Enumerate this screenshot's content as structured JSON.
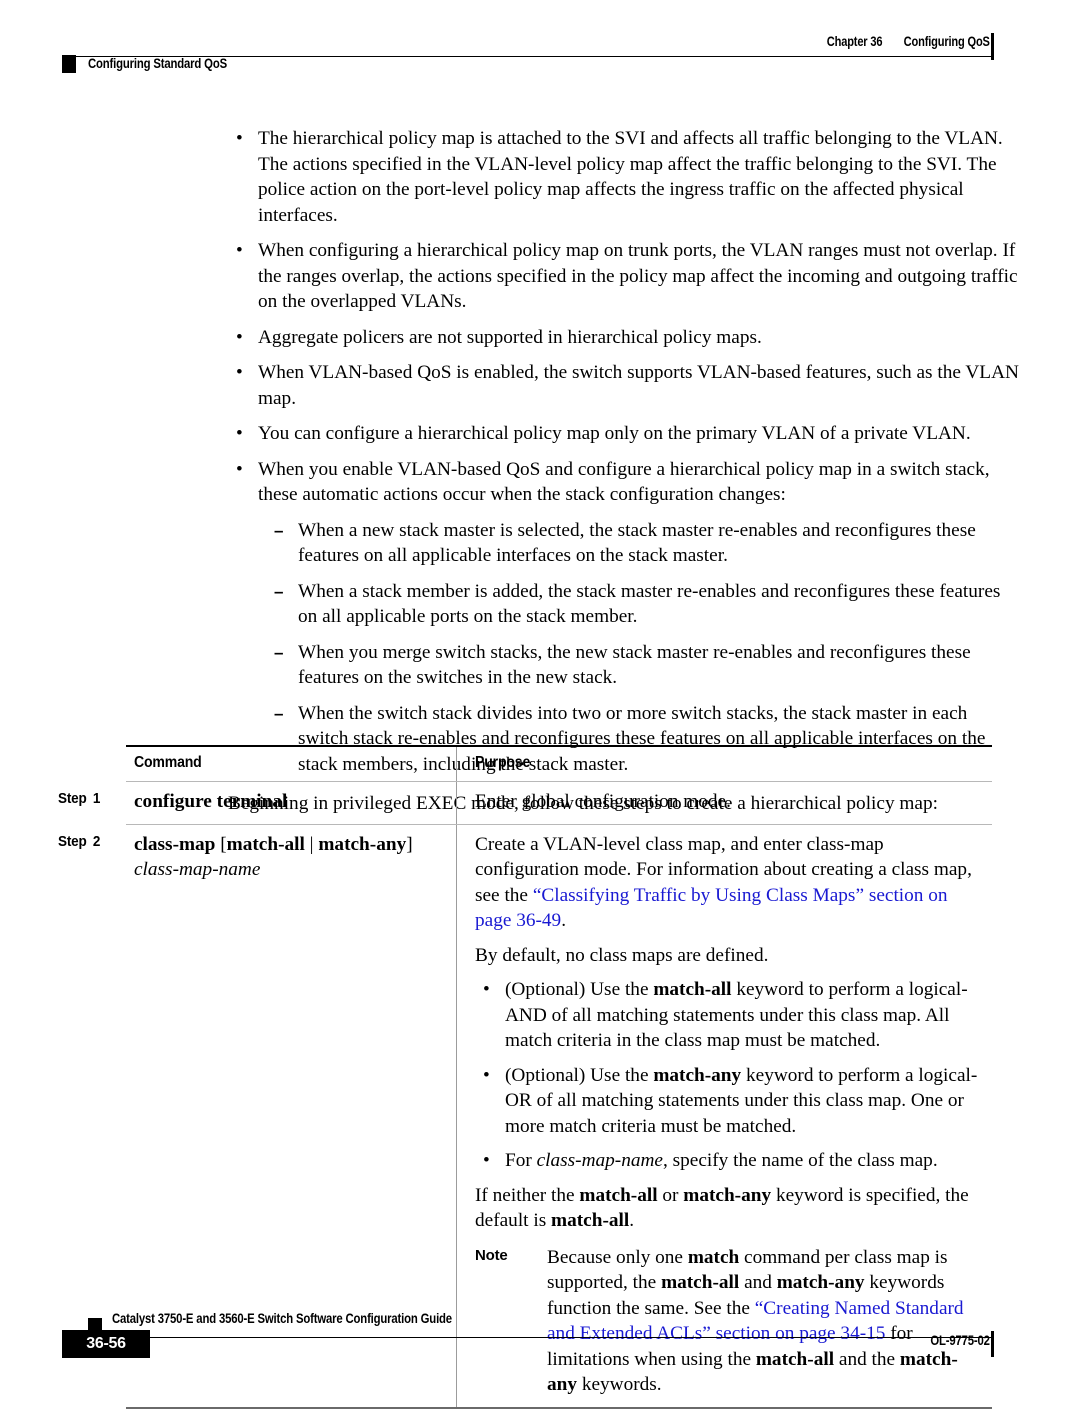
{
  "header": {
    "chapter": "Chapter 36",
    "chapter_title": "Configuring QoS",
    "section_title": "Configuring Standard QoS"
  },
  "body": {
    "bullets": [
      {
        "marker": "•",
        "text": "The hierarchical policy map is attached to the SVI and affects all traffic belonging to the VLAN. The actions specified in the VLAN-level policy map affect the traffic belonging to the SVI. The police action on the port-level policy map affects the ingress traffic on the affected physical interfaces."
      },
      {
        "marker": "•",
        "text": "When configuring a hierarchical policy map on trunk ports, the VLAN ranges must not overlap. If the ranges overlap, the actions specified in the policy map affect the incoming and outgoing traffic on the overlapped VLANs."
      },
      {
        "marker": "•",
        "text": "Aggregate policers are not supported in hierarchical policy maps."
      },
      {
        "marker": "•",
        "text": "When VLAN-based QoS is enabled, the switch supports VLAN-based features, such as the VLAN map."
      },
      {
        "marker": "•",
        "text": "You can configure a hierarchical policy map only on the primary VLAN of a private VLAN."
      },
      {
        "marker": "•",
        "text": "When you enable VLAN-based QoS and configure a hierarchical policy map in a switch stack, these automatic actions occur when the stack configuration changes:"
      }
    ],
    "sub_bullets": [
      {
        "marker": "–",
        "text": "When a new stack master is selected, the stack master re-enables and reconfigures these features on all applicable interfaces on the stack master."
      },
      {
        "marker": "–",
        "text": "When a stack member is added, the stack master re-enables and reconfigures these features on all applicable ports on the stack member."
      },
      {
        "marker": "–",
        "text": "When you merge switch stacks, the new stack master re-enables and reconfigures these features on the switches in the new stack."
      },
      {
        "marker": "–",
        "text": "When the switch stack divides into two or more switch stacks, the stack master in each switch stack re-enables and reconfigures these features on all applicable interfaces on the stack members, including the stack master."
      }
    ],
    "intro_paragraph": "Beginning in privileged EXEC mode, follow these steps to create a hierarchical policy map:"
  },
  "table": {
    "headers": {
      "command": "Command",
      "purpose": "Purpose"
    },
    "rows": [
      {
        "step_word": "Step",
        "step_number": "1",
        "command_bold": "configure terminal",
        "command_italic": "",
        "purpose_text": "Enter global configuration mode."
      },
      {
        "step_word": "Step",
        "step_number": "2",
        "command_prefix": "class-map",
        "command_bracket_open": " [",
        "command_opt1": "match-all",
        "command_pipe": " | ",
        "command_opt2": "match-any",
        "command_bracket_close": "]",
        "command_italic": "class-map-name",
        "purpose": {
          "p1_a": "Create a VLAN-level class map, and enter class-map configuration mode. For information about creating a class map, see the ",
          "p1_link": "“Classifying Traffic by Using Class Maps” section on page 36-49",
          "p1_b": ".",
          "p2": "By default, no class maps are defined.",
          "b1_a": "(Optional) Use the ",
          "b1_kw": "match-all",
          "b1_b": " keyword to perform a logical-AND of all matching statements under this class map. All match criteria in the class map must be matched.",
          "b2_a": "(Optional) Use the ",
          "b2_kw": "match-any",
          "b2_b": " keyword to perform a logical-OR of all matching statements under this class map. One or more match criteria must be matched.",
          "b3_a": "For ",
          "b3_italic": "class-map-name",
          "b3_b": ", specify the name of the class map.",
          "p3_a": "If neither the ",
          "p3_kw1": "match-all",
          "p3_b": " or ",
          "p3_kw2": "match-any",
          "p3_c": " keyword is specified, the default is ",
          "p3_kw3": "match-all",
          "p3_d": ".",
          "note_tag": "Note",
          "note_a": "Because only one ",
          "note_kw1": "match",
          "note_b": " command per class map is supported, the ",
          "note_kw2": "match-all",
          "note_c": " and ",
          "note_kw3": "match-any",
          "note_d": " keywords function the same. See the ",
          "note_link": "“Creating Named Standard and Extended ACLs” section on page 34-15",
          "note_e": " for limitations when using the ",
          "note_kw4": "match-all",
          "note_f": " and the ",
          "note_kw5": "match-any",
          "note_g": " keywords."
        }
      }
    ]
  },
  "footer": {
    "doc_title": "Catalyst 3750-E and 3560-E Switch Software Configuration Guide",
    "page_number": "36-56",
    "doc_number": "OL-9775-02"
  },
  "colors": {
    "link": "#1919d2",
    "text": "#000000",
    "rule": "#000000"
  }
}
